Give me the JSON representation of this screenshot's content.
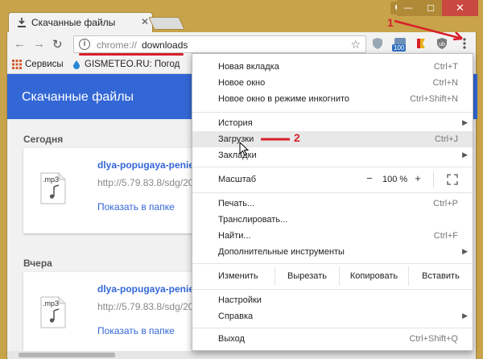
{
  "window": {
    "tab_title": "Скачанные файлы",
    "tab_close": "✕",
    "min": "—",
    "max": "☐",
    "close": "✕"
  },
  "toolbar": {
    "back": "←",
    "forward": "→",
    "reload": "↻",
    "url_scheme": "chrome://",
    "url_host": "downloads",
    "info": "i",
    "ext_badge": "100"
  },
  "bookmarks": [
    {
      "label": "Сервисы"
    },
    {
      "label": "GISMETEO.RU: Погод"
    }
  ],
  "downloads": {
    "header": "Скачанные файлы",
    "sections": [
      {
        "label": "Сегодня",
        "file": {
          "name": "dlya-popugaya-penie-pt",
          "url": "http://5.79.83.8/sdg/20",
          "action": "Показать в папке",
          "ext": ".mp3"
        }
      },
      {
        "label": "Вчера",
        "file": {
          "name": "dlya-popugaya-penie-pt",
          "url": "http://5.79.83.8/sdg/20",
          "action": "Показать в папке",
          "ext": ".mp3"
        }
      }
    ]
  },
  "menu": {
    "items_top": [
      {
        "label": "Новая вкладка",
        "shortcut": "Ctrl+T"
      },
      {
        "label": "Новое окно",
        "shortcut": "Ctrl+N"
      },
      {
        "label": "Новое окно в режиме инкогнито",
        "shortcut": "Ctrl+Shift+N"
      }
    ],
    "items_history": [
      {
        "label": "История",
        "shortcut": ""
      },
      {
        "label": "Загрузки",
        "shortcut": "Ctrl+J"
      },
      {
        "label": "Закладки",
        "shortcut": ""
      }
    ],
    "zoom": {
      "label": "Масштаб",
      "minus": "−",
      "value": "100 %",
      "plus": "+"
    },
    "items_tools": [
      {
        "label": "Печать...",
        "shortcut": "Ctrl+P"
      },
      {
        "label": "Транслировать...",
        "shortcut": ""
      },
      {
        "label": "Найти...",
        "shortcut": "Ctrl+F"
      },
      {
        "label": "Дополнительные инструменты",
        "shortcut": ""
      }
    ],
    "edit": {
      "label": "Изменить",
      "cut": "Вырезать",
      "copy": "Копировать",
      "paste": "Вставить"
    },
    "items_settings": [
      {
        "label": "Настройки",
        "shortcut": ""
      },
      {
        "label": "Справка",
        "shortcut": ""
      }
    ],
    "exit": {
      "label": "Выход",
      "shortcut": "Ctrl+Shift+Q"
    }
  },
  "annotations": {
    "one": "1",
    "two": "2"
  },
  "colors": {
    "accent": "#3367d6",
    "annotation": "#d8202a",
    "frame": "#c8a34a"
  }
}
